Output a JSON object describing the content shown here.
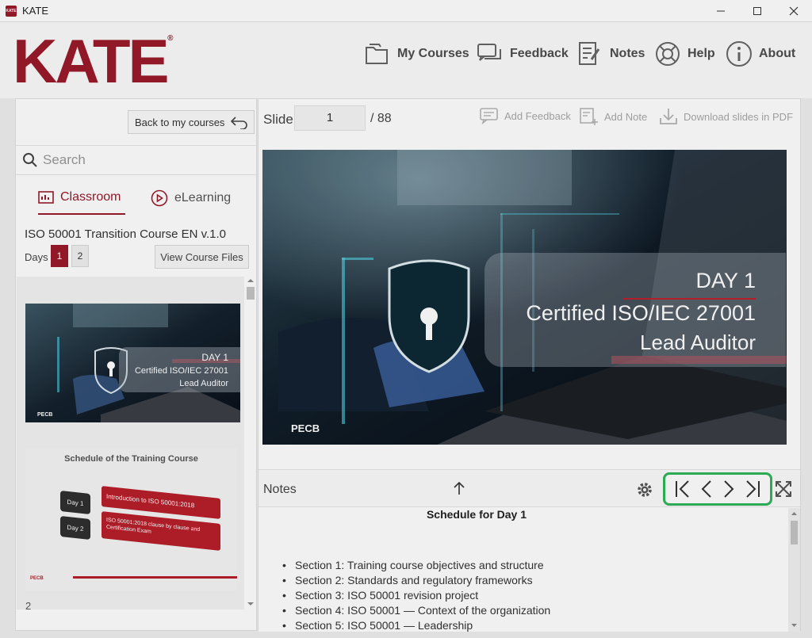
{
  "window": {
    "app_icon_text": "KATE",
    "title": "KATE",
    "minimize_icon": "minimize-icon",
    "maximize_icon": "maximize-icon",
    "close_icon": "close-icon"
  },
  "header": {
    "logo": "KATE",
    "logo_mark": "®",
    "nav": [
      {
        "label": "My Courses",
        "icon": "folder-icon"
      },
      {
        "label": "Feedback",
        "icon": "chat-icon"
      },
      {
        "label": "Notes",
        "icon": "notes-icon"
      },
      {
        "label": "Help",
        "icon": "lifebuoy-icon"
      },
      {
        "label": "About",
        "icon": "info-icon"
      }
    ]
  },
  "sidebar": {
    "back_label": "Back to my courses",
    "search_placeholder": "Search",
    "tabs": [
      {
        "label": "Classroom",
        "active": true
      },
      {
        "label": "eLearning",
        "active": false
      }
    ],
    "course_title": "ISO 50001 Transition Course  EN v.1.0",
    "days_label": "Days",
    "days": [
      "1",
      "2"
    ],
    "view_files_label": "View Course Files",
    "thumb1": {
      "line1": "DAY 1",
      "line2": "Certified ISO/IEC 27001",
      "line3": "Lead Auditor",
      "brand": "PECB"
    },
    "thumb2": {
      "title": "Schedule of the Training Course",
      "day1": "Day 1",
      "day2": "Day 2",
      "item1": "Introduction to ISO 50001:2018",
      "item2": "ISO 50001:2018 clause by clause and Certification Exam",
      "brand": "PECB"
    },
    "page_number": "2"
  },
  "content": {
    "slide_label": "Slide",
    "slide_current": "1",
    "slide_total": "/ 88",
    "tools": [
      {
        "label": "Add Feedback",
        "icon": "feedback-icon"
      },
      {
        "label": "Add Note",
        "icon": "add-note-icon"
      },
      {
        "label": "Download slides in PDF",
        "icon": "download-icon"
      }
    ],
    "slide": {
      "line1": "DAY 1",
      "line2": "Certified ISO/IEC 27001",
      "line3": "Lead Auditor",
      "brand": "PECB"
    },
    "notes_label": "Notes",
    "notes_title": "Schedule for Day 1",
    "notes_items": [
      "Section 1: Training course objectives and structure",
      "Section 2: Standards and regulatory frameworks",
      "Section 3: ISO 50001 revision project",
      "Section 4: ISO 50001 — Context of the organization",
      "Section 5: ISO 50001 — Leadership"
    ]
  },
  "colors": {
    "brand": "#9b1b2a",
    "highlight": "#2fb55a"
  }
}
